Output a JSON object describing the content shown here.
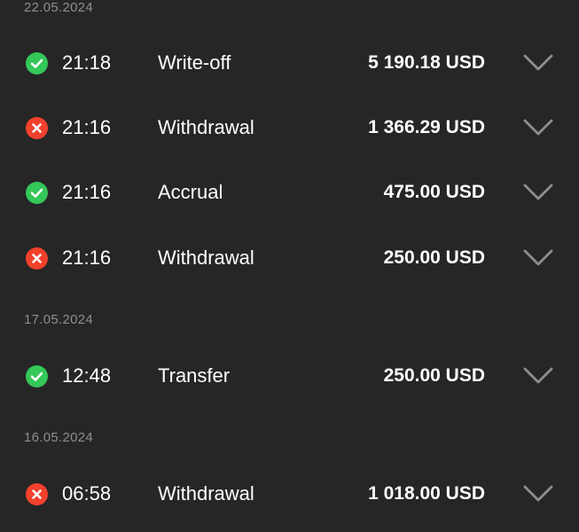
{
  "groups": [
    {
      "date": "22.05.2024",
      "items": [
        {
          "status": "success",
          "time": "21:18",
          "type": "Write-off",
          "amount": "5 190.18 USD"
        },
        {
          "status": "failed",
          "time": "21:16",
          "type": "Withdrawal",
          "amount": "1 366.29 USD"
        },
        {
          "status": "success",
          "time": "21:16",
          "type": "Accrual",
          "amount": "475.00 USD"
        },
        {
          "status": "failed",
          "time": "21:16",
          "type": "Withdrawal",
          "amount": "250.00 USD"
        }
      ]
    },
    {
      "date": "17.05.2024",
      "items": [
        {
          "status": "success",
          "time": "12:48",
          "type": "Transfer",
          "amount": "250.00 USD"
        }
      ]
    },
    {
      "date": "16.05.2024",
      "items": [
        {
          "status": "failed",
          "time": "06:58",
          "type": "Withdrawal",
          "amount": "1 018.00 USD"
        }
      ]
    }
  ],
  "colors": {
    "background": "#262626",
    "success": "#34c759",
    "failed": "#f2412c",
    "date_text": "#8e8e8e",
    "chevron": "#8e8e8e"
  },
  "icons": {
    "success": "check-circle-icon",
    "failed": "x-circle-icon",
    "expand": "chevron-down-icon"
  }
}
